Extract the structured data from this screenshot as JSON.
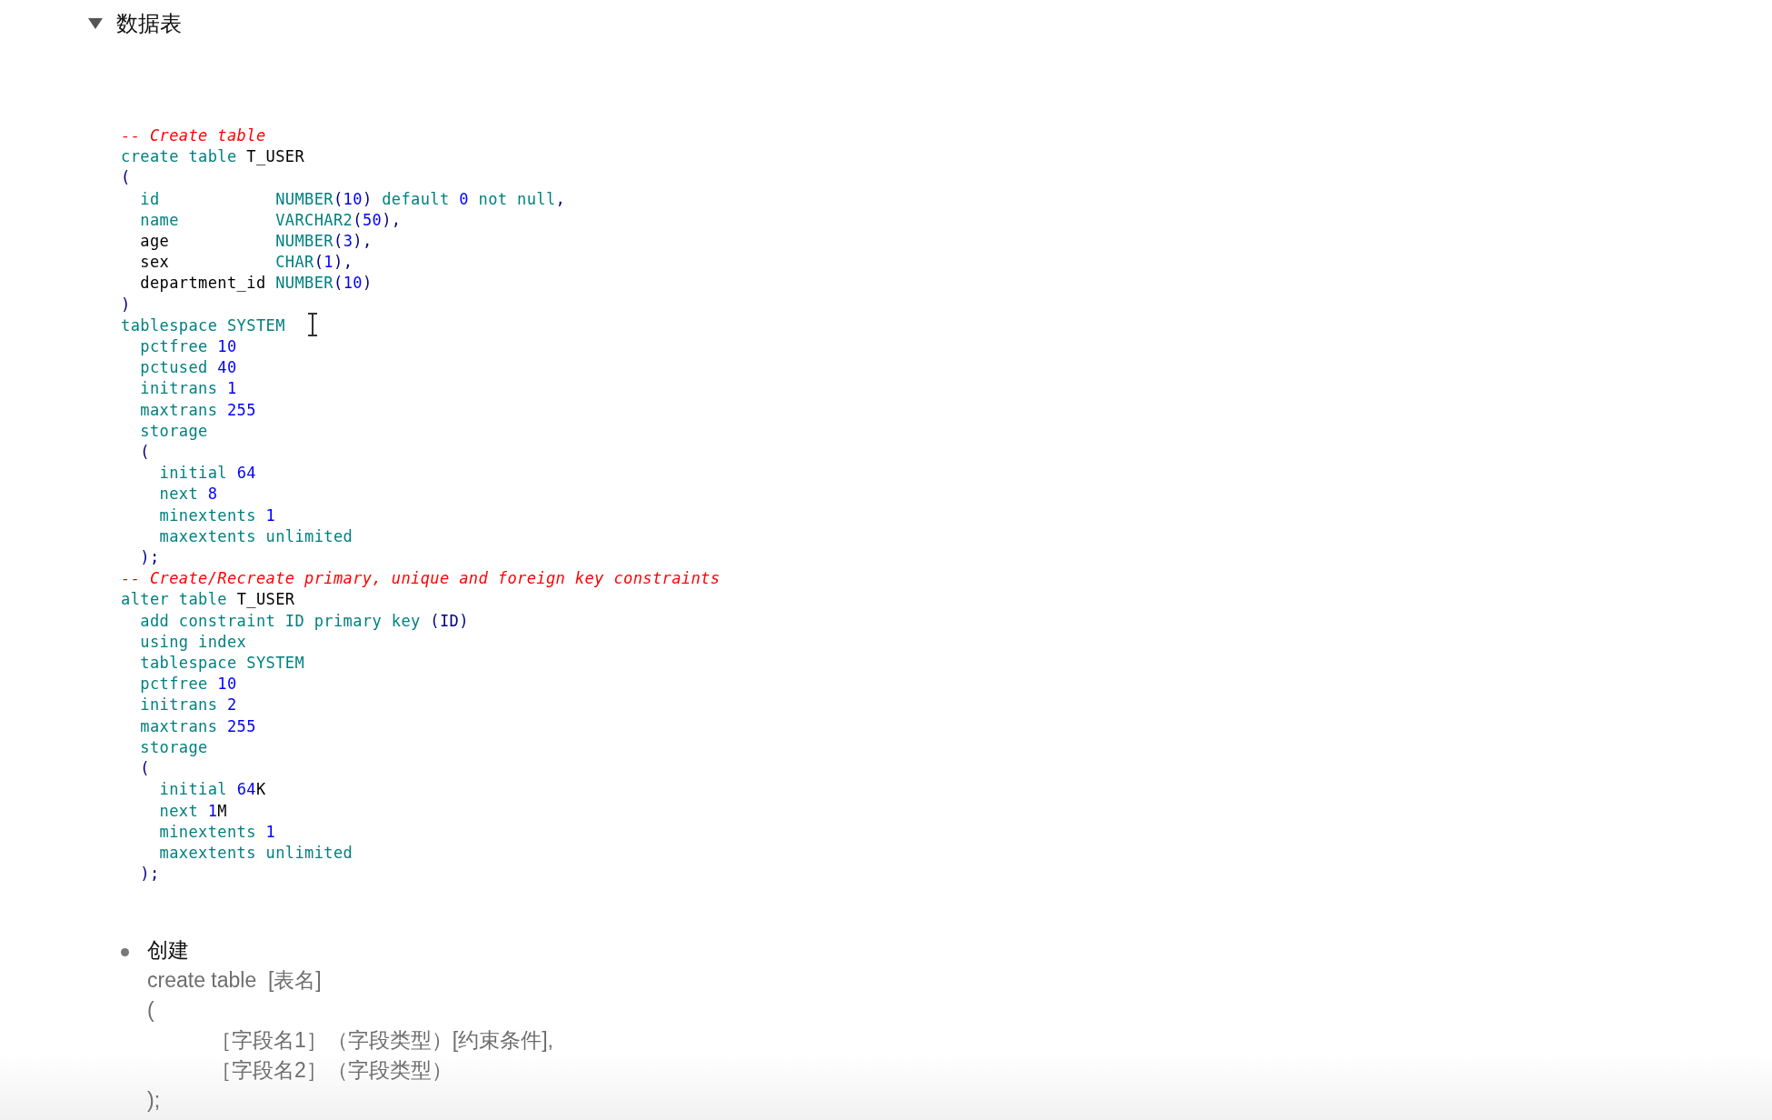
{
  "section": {
    "title": "数据表",
    "expanded": true
  },
  "code": [
    {
      "tokens": [
        {
          "kind": "comment",
          "text": "-- Create table"
        }
      ]
    },
    {
      "tokens": [
        {
          "kind": "keyword",
          "text": "create table "
        },
        {
          "kind": "name",
          "text": "T_USER"
        }
      ]
    },
    {
      "tokens": [
        {
          "kind": "paren",
          "text": "("
        }
      ]
    },
    {
      "tokens": [
        {
          "kind": "keyword",
          "text": "  id            NUMBER"
        },
        {
          "kind": "paren",
          "text": "("
        },
        {
          "kind": "number",
          "text": "10"
        },
        {
          "kind": "paren",
          "text": ")"
        },
        {
          "kind": "keyword",
          "text": " default "
        },
        {
          "kind": "number",
          "text": "0"
        },
        {
          "kind": "keyword",
          "text": " not null"
        },
        {
          "kind": "paren",
          "text": ","
        }
      ]
    },
    {
      "tokens": [
        {
          "kind": "keyword",
          "text": "  name          VARCHAR2"
        },
        {
          "kind": "paren",
          "text": "("
        },
        {
          "kind": "number",
          "text": "50"
        },
        {
          "kind": "paren",
          "text": "),"
        }
      ]
    },
    {
      "tokens": [
        {
          "kind": "name",
          "text": "  age           "
        },
        {
          "kind": "keyword",
          "text": "NUMBER"
        },
        {
          "kind": "paren",
          "text": "("
        },
        {
          "kind": "number",
          "text": "3"
        },
        {
          "kind": "paren",
          "text": "),"
        }
      ]
    },
    {
      "tokens": [
        {
          "kind": "name",
          "text": "  sex           "
        },
        {
          "kind": "keyword",
          "text": "CHAR"
        },
        {
          "kind": "paren",
          "text": "("
        },
        {
          "kind": "number",
          "text": "1"
        },
        {
          "kind": "paren",
          "text": "),"
        }
      ]
    },
    {
      "tokens": [
        {
          "kind": "name",
          "text": "  department_id "
        },
        {
          "kind": "keyword",
          "text": "NUMBER"
        },
        {
          "kind": "paren",
          "text": "("
        },
        {
          "kind": "number",
          "text": "10"
        },
        {
          "kind": "paren",
          "text": ")"
        }
      ]
    },
    {
      "tokens": [
        {
          "kind": "paren",
          "text": ")"
        }
      ]
    },
    {
      "tokens": [
        {
          "kind": "keyword",
          "text": "tablespace SYSTEM"
        }
      ]
    },
    {
      "tokens": [
        {
          "kind": "keyword",
          "text": "  pctfree "
        },
        {
          "kind": "number",
          "text": "10"
        }
      ]
    },
    {
      "tokens": [
        {
          "kind": "keyword",
          "text": "  pctused "
        },
        {
          "kind": "number",
          "text": "40"
        }
      ]
    },
    {
      "tokens": [
        {
          "kind": "keyword",
          "text": "  initrans "
        },
        {
          "kind": "number",
          "text": "1"
        }
      ]
    },
    {
      "tokens": [
        {
          "kind": "keyword",
          "text": "  maxtrans "
        },
        {
          "kind": "number",
          "text": "255"
        }
      ]
    },
    {
      "tokens": [
        {
          "kind": "keyword",
          "text": "  storage"
        }
      ]
    },
    {
      "tokens": [
        {
          "kind": "paren",
          "text": "  ("
        }
      ]
    },
    {
      "tokens": [
        {
          "kind": "keyword",
          "text": "    initial "
        },
        {
          "kind": "number",
          "text": "64"
        }
      ]
    },
    {
      "tokens": [
        {
          "kind": "keyword",
          "text": "    next "
        },
        {
          "kind": "number",
          "text": "8"
        }
      ]
    },
    {
      "tokens": [
        {
          "kind": "keyword",
          "text": "    minextents "
        },
        {
          "kind": "number",
          "text": "1"
        }
      ]
    },
    {
      "tokens": [
        {
          "kind": "keyword",
          "text": "    maxextents unlimited"
        }
      ]
    },
    {
      "tokens": [
        {
          "kind": "paren",
          "text": "  );"
        }
      ]
    },
    {
      "tokens": [
        {
          "kind": "comment",
          "text": "-- Create/Recreate primary, unique and foreign key constraints"
        }
      ]
    },
    {
      "tokens": [
        {
          "kind": "keyword",
          "text": "alter table "
        },
        {
          "kind": "name",
          "text": "T_USER"
        }
      ]
    },
    {
      "tokens": [
        {
          "kind": "keyword",
          "text": "  add constraint ID primary key "
        },
        {
          "kind": "paren",
          "text": "(ID)"
        }
      ]
    },
    {
      "tokens": [
        {
          "kind": "keyword",
          "text": "  using index"
        }
      ]
    },
    {
      "tokens": [
        {
          "kind": "keyword",
          "text": "  tablespace SYSTEM"
        }
      ]
    },
    {
      "tokens": [
        {
          "kind": "keyword",
          "text": "  pctfree "
        },
        {
          "kind": "number",
          "text": "10"
        }
      ]
    },
    {
      "tokens": [
        {
          "kind": "keyword",
          "text": "  initrans "
        },
        {
          "kind": "number",
          "text": "2"
        }
      ]
    },
    {
      "tokens": [
        {
          "kind": "keyword",
          "text": "  maxtrans "
        },
        {
          "kind": "number",
          "text": "255"
        }
      ]
    },
    {
      "tokens": [
        {
          "kind": "keyword",
          "text": "  storage"
        }
      ]
    },
    {
      "tokens": [
        {
          "kind": "paren",
          "text": "  ("
        }
      ]
    },
    {
      "tokens": [
        {
          "kind": "keyword",
          "text": "    initial "
        },
        {
          "kind": "number",
          "text": "64"
        },
        {
          "kind": "name",
          "text": "K"
        }
      ]
    },
    {
      "tokens": [
        {
          "kind": "keyword",
          "text": "    next "
        },
        {
          "kind": "number",
          "text": "1"
        },
        {
          "kind": "name",
          "text": "M"
        }
      ]
    },
    {
      "tokens": [
        {
          "kind": "keyword",
          "text": "    minextents "
        },
        {
          "kind": "number",
          "text": "1"
        }
      ]
    },
    {
      "tokens": [
        {
          "kind": "keyword",
          "text": "    maxextents unlimited"
        }
      ]
    },
    {
      "tokens": [
        {
          "kind": "paren",
          "text": "  );"
        }
      ]
    }
  ],
  "list": [
    {
      "title": "创建",
      "lines": [
        {
          "kind": "plain",
          "text": "create table  [表名]"
        },
        {
          "kind": "plain",
          "text": "("
        },
        {
          "kind": "indented",
          "text": "［字段名1］（字段类型）[约束条件],"
        },
        {
          "kind": "indented",
          "text": "［字段名2］（字段类型）"
        },
        {
          "kind": "plain",
          "text": ");"
        }
      ]
    }
  ]
}
